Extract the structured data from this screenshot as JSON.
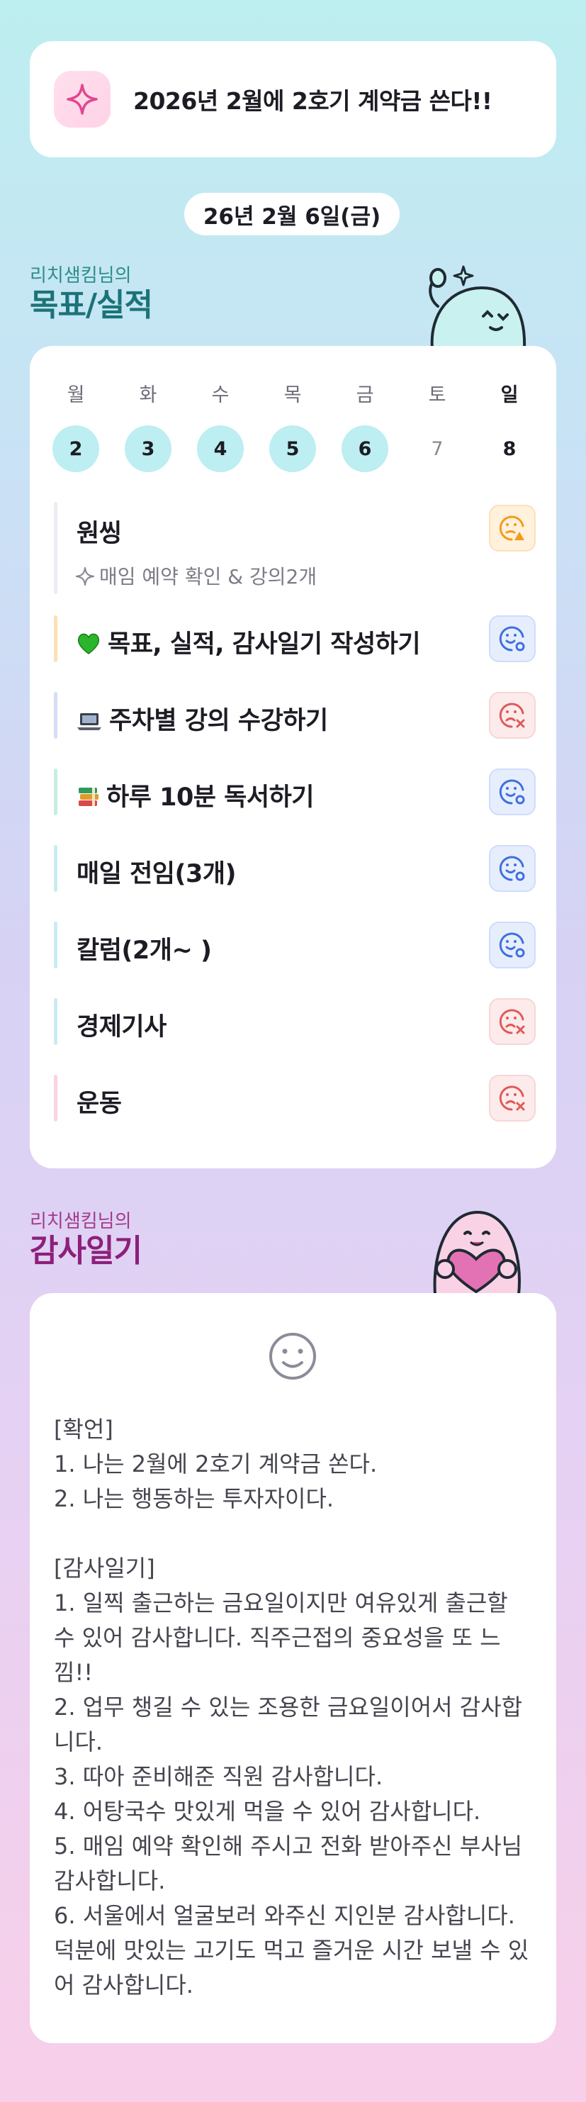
{
  "banner": {
    "goal_text": "2026년 2월에 2호기 계약금 쓴다!!"
  },
  "date": "26년 2월 6일(금)",
  "goals_section": {
    "subtitle": "리치샘킴님의",
    "title": "목표/실적"
  },
  "week": {
    "days": [
      {
        "label": "월",
        "num": "2",
        "state": "active"
      },
      {
        "label": "화",
        "num": "3",
        "state": "active"
      },
      {
        "label": "수",
        "num": "4",
        "state": "active"
      },
      {
        "label": "목",
        "num": "5",
        "state": "active"
      },
      {
        "label": "금",
        "num": "6",
        "state": "active"
      },
      {
        "label": "토",
        "num": "7",
        "state": "inactive"
      },
      {
        "label": "일",
        "num": "8",
        "state": "sunday"
      }
    ]
  },
  "tasks": [
    {
      "title": "원씽",
      "subtitle": "매임 예약 확인 & 강의2개",
      "status": "partial",
      "bar_color": "#ececf2",
      "icon": ""
    },
    {
      "title": "목표, 실적, 감사일기 작성하기",
      "status": "done",
      "bar_color": "#fde0b4",
      "icon": "green-heart-icon"
    },
    {
      "title": "주차별 강의 수강하기",
      "status": "missed",
      "bar_color": "#d9dcf8",
      "icon": "laptop-icon"
    },
    {
      "title": "하루 10분 독서하기",
      "status": "done",
      "bar_color": "#c6eedf",
      "icon": "books-icon"
    },
    {
      "title": "매일 전임(3개)",
      "status": "done",
      "bar_color": "#c9ecf0",
      "icon": ""
    },
    {
      "title": "칼럼(2개~ )",
      "status": "done",
      "bar_color": "#c9ecf0",
      "icon": ""
    },
    {
      "title": "경제기사",
      "status": "missed",
      "bar_color": "#c9ecf0",
      "icon": ""
    },
    {
      "title": "운동",
      "status": "missed",
      "bar_color": "#fcd2e4",
      "icon": ""
    }
  ],
  "gratitude_section": {
    "subtitle": "리치샘킴님의",
    "title": "감사일기"
  },
  "gratitude": {
    "body": "[확언]\n1. 나는 2월에 2호기 계약금 쏜다.\n2. 나는 행동하는 투자자이다.\n\n[감사일기]\n1. 일찍 출근하는 금요일이지만 여유있게 출근할 수 있어 감사합니다. 직주근접의 중요성을 또 느낌!!\n2. 업무 챙길 수 있는 조용한 금요일이어서 감사합니다.\n3. 따아 준비해준 직원 감사합니다.\n4. 어탕국수 맛있게 먹을 수 있어 감사합니다.\n5. 매임 예약 확인해 주시고 전화 받아주신 부사님 감사합니다.\n6. 서울에서 얼굴보러 와주신 지인분 감사합니다. 덕분에 맛있는 고기도 먹고 즐거운 시간 보낼 수 있어 감사합니다."
  },
  "colors": {
    "accent_teal": "#1b7378",
    "accent_magenta": "#8d1f7a",
    "status_good": "#3f6fe0",
    "status_bad": "#e05a5a",
    "status_partial": "#f59a1b"
  }
}
